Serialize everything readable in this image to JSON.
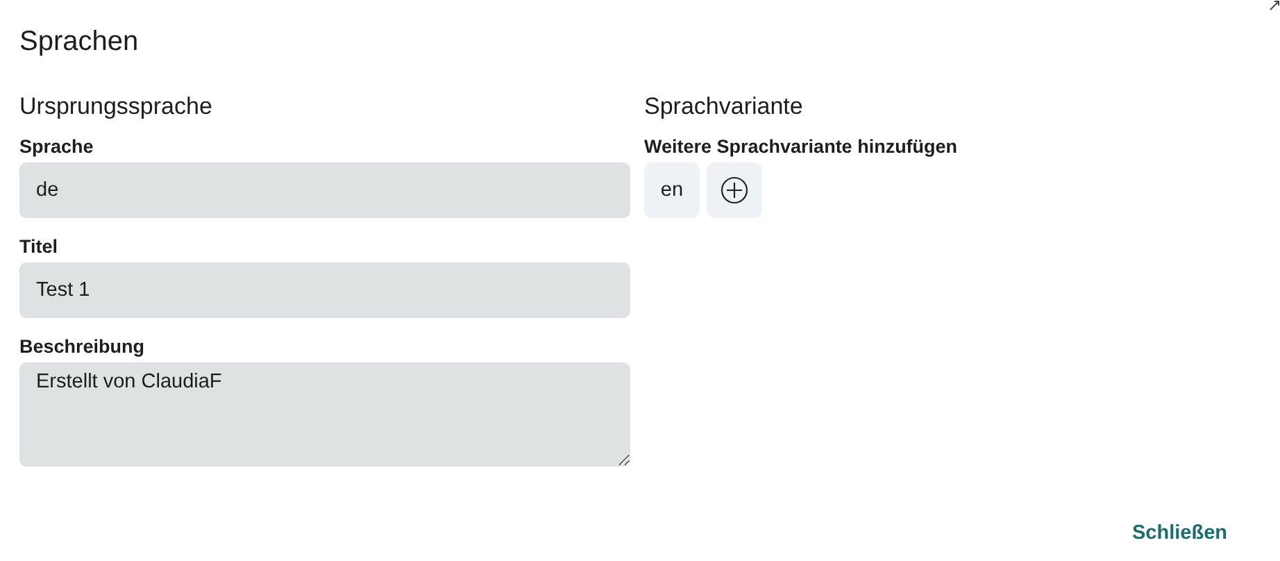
{
  "dialog": {
    "title": "Sprachen"
  },
  "origin": {
    "heading": "Ursprungssprache",
    "fields": [
      {
        "kind": "input",
        "label": "Sprache",
        "value": "de"
      },
      {
        "kind": "input",
        "label": "Titel",
        "value": "Test 1"
      },
      {
        "kind": "textarea",
        "label": "Beschreibung",
        "value": "Erstellt von ClaudiaF"
      }
    ]
  },
  "variants": {
    "heading": "Sprachvariante",
    "label": "Weitere Sprachvariante hinzufügen",
    "items": [
      {
        "label": "en"
      }
    ]
  },
  "buttons": [
    "Schließen"
  ]
}
